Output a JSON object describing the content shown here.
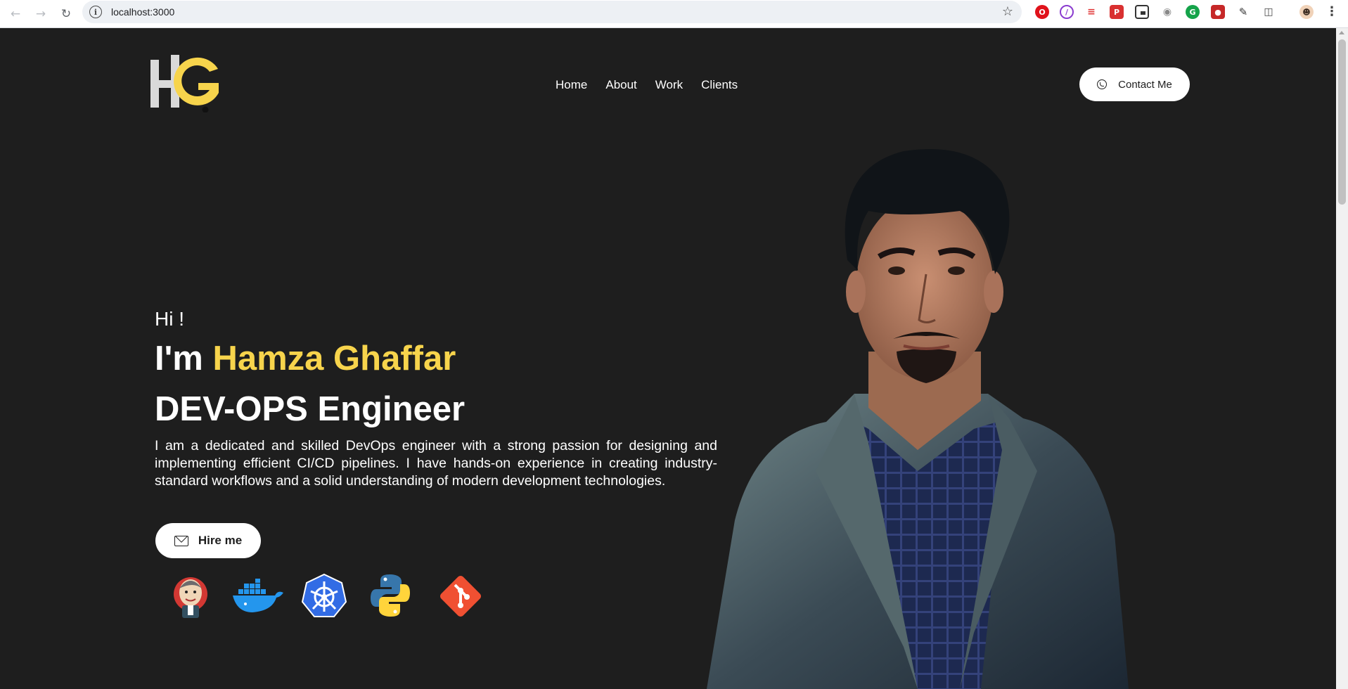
{
  "browser": {
    "url": "localhost:3000",
    "extensions": [
      "opera-icon",
      "block-icon",
      "stack-icon",
      "pdf-icon",
      "pip-icon",
      "camera-icon",
      "grammar-icon",
      "record-icon",
      "eyedropper-icon",
      "puzzle-icon"
    ],
    "profile": "avatar"
  },
  "site": {
    "logo_text": "HG",
    "colors": {
      "background": "#1e1e1e",
      "accent": "#f7d44c",
      "button": "#ffffff"
    },
    "nav": {
      "items": [
        "Home",
        "About",
        "Work",
        "Clients"
      ]
    },
    "contact_label": "Contact Me",
    "hero": {
      "greeting": "Hi !",
      "intro_prefix": "I'm ",
      "name": "Hamza Ghaffar",
      "role": "DEV-OPS Engineer",
      "description": "I am a dedicated and skilled DevOps engineer with a strong passion for designing and implementing efficient CI/CD pipelines. I have hands-on experience in creating industry-standard workflows and a solid understanding of modern development technologies.",
      "hire_label": "Hire me",
      "tools": [
        "jenkins-icon",
        "docker-icon",
        "kubernetes-icon",
        "python-icon",
        "git-icon"
      ]
    }
  }
}
